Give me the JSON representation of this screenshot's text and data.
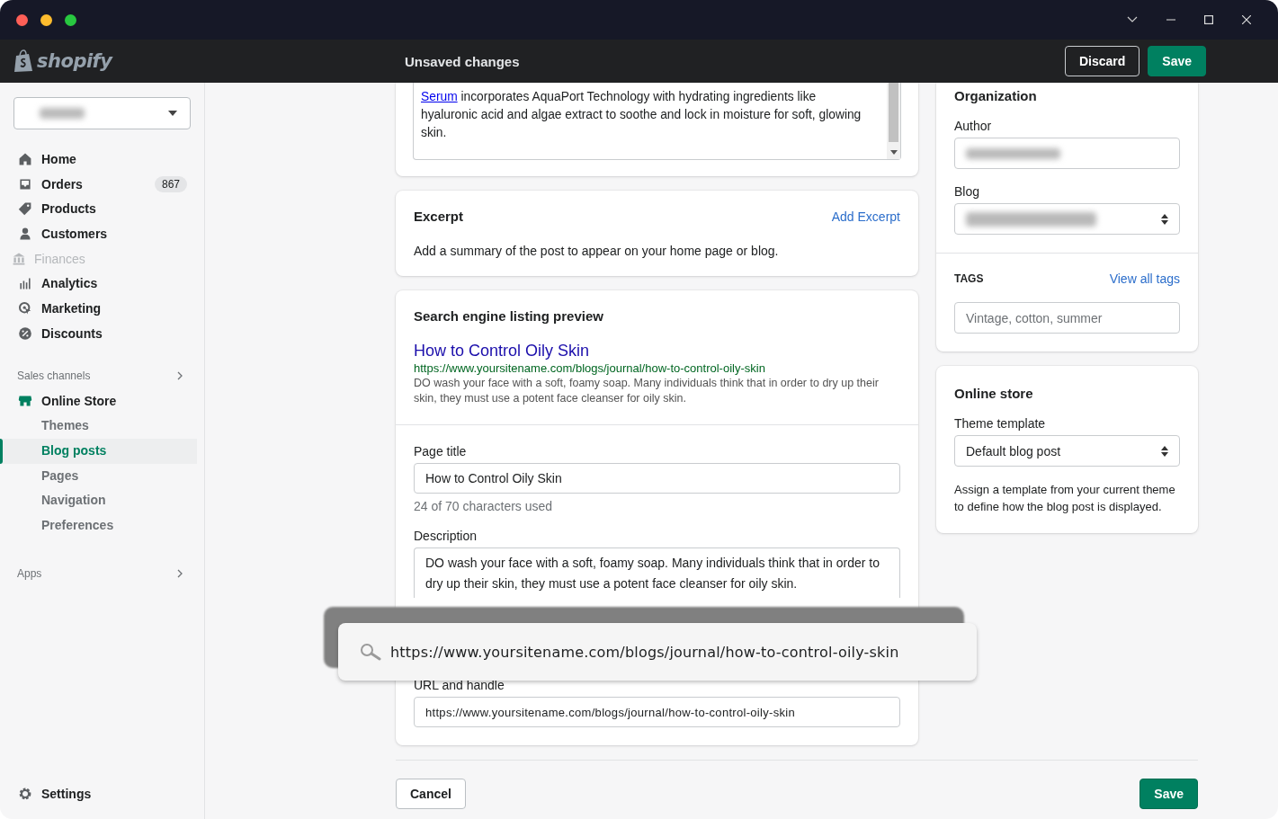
{
  "topbar": {
    "logo": "shopify",
    "title": "Unsaved changes",
    "buttons": [
      {
        "label": "Discard",
        "kind": "secondary"
      },
      {
        "label": "Save",
        "kind": "primary"
      }
    ]
  },
  "sidebar": {
    "items": [
      {
        "label": "Home",
        "disabled": false
      },
      {
        "label": "Orders",
        "badge": "867",
        "disabled": false
      },
      {
        "label": "Products",
        "disabled": false
      },
      {
        "label": "Customers",
        "disabled": false
      },
      {
        "label": "Finances",
        "disabled": true
      },
      {
        "label": "Analytics",
        "disabled": false
      },
      {
        "label": "Marketing",
        "disabled": false
      },
      {
        "label": "Discounts",
        "disabled": false
      }
    ],
    "sales_channels": {
      "label": "Sales channels",
      "channel": {
        "label": "Online Store",
        "children": [
          {
            "label": "Themes",
            "selected": false
          },
          {
            "label": "Blog posts",
            "selected": true
          },
          {
            "label": "Pages",
            "selected": false
          },
          {
            "label": "Navigation",
            "selected": false
          },
          {
            "label": "Preferences",
            "selected": false
          }
        ]
      }
    },
    "apps": {
      "label": "Apps"
    },
    "settings": "Settings"
  },
  "content": {
    "parts": [
      {
        "kind": "link",
        "text": "Serum"
      },
      {
        "kind": "text",
        "text": " incorporates AquaPort Technology with hydrating ingredients like hyaluronic acid and algae extract to soothe and lock in moisture for soft, glowing skin."
      }
    ]
  },
  "excerpt": {
    "title": "Excerpt",
    "action": "Add Excerpt",
    "text": "Add a summary of the post to appear on your home page or blog."
  },
  "seo": {
    "title": "Search engine listing preview",
    "preview": {
      "title": "How to Control Oily Skin",
      "url": "https://www.yoursitename.com/blogs/journal/how-to-control-oily-skin",
      "description": "DO wash your face with a soft, foamy soap. Many individuals think that in order to dry up their skin, they must use a potent face cleanser for oily skin."
    },
    "page_title": {
      "label": "Page title",
      "value": "How to Control Oily Skin",
      "hint": "24 of 70 characters used"
    },
    "description": {
      "label": "Description",
      "value": "DO wash your face with a soft, foamy soap. Many individuals think that in order to dry up their skin, they must use a potent face cleanser for oily skin."
    },
    "url_handle": {
      "label": "URL and handle",
      "value": "https://www.yoursitename.com/blogs/journal/how-to-control-oily-skin"
    }
  },
  "overlay": {
    "url": "https://www.yoursitename.com/blogs/journal/how-to-control-oily-skin"
  },
  "footer": {
    "cancel": "Cancel",
    "save": "Save"
  },
  "organization": {
    "title": "Organization",
    "author": {
      "label": "Author"
    },
    "blog": {
      "label": "Blog"
    },
    "tags": {
      "label": "TAGS",
      "action": "View all tags",
      "placeholder": "Vintage, cotton, summer"
    }
  },
  "online_store": {
    "title": "Online store",
    "template": {
      "label": "Theme template",
      "value": "Default blog post"
    },
    "help": "Assign a template from your current theme to define how the blog post is displayed."
  }
}
